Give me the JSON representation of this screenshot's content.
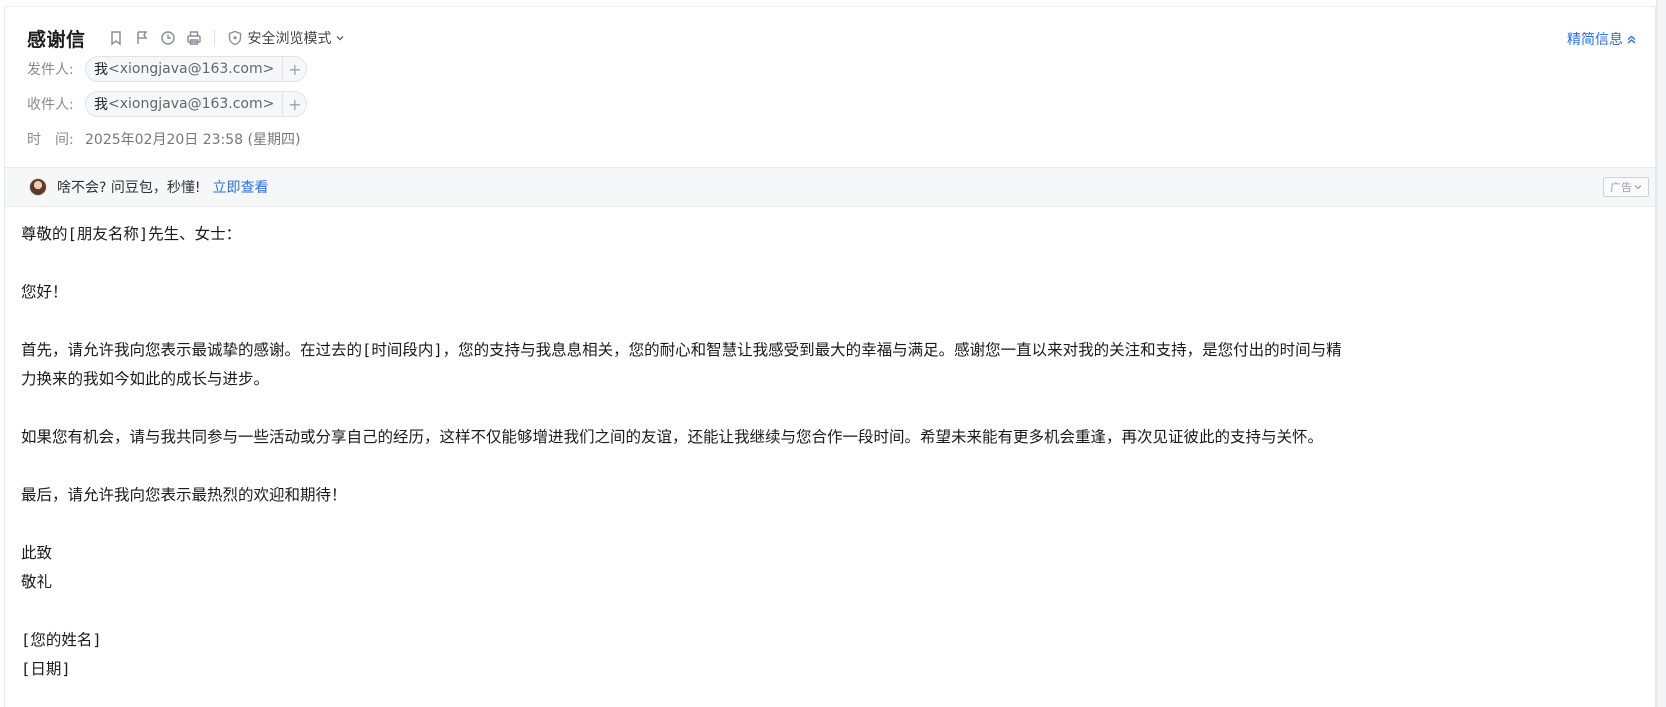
{
  "email": {
    "subject": "感谢信",
    "safe_mode_label": "安全浏览模式",
    "simplify_label": "精简信息",
    "sender": {
      "label": "发件人:",
      "name": "我",
      "address": "<xiongjava@163.com>"
    },
    "recipient": {
      "label": "收件人:",
      "name": "我",
      "address": "<xiongjava@163.com>"
    },
    "time": {
      "label": "时　间:",
      "value": "2025年02月20日 23:58 (星期四)"
    },
    "toolbar_icons": [
      "bookmark-icon",
      "flag-icon",
      "clock-icon",
      "print-icon"
    ],
    "add_symbol": "+"
  },
  "ad": {
    "text": "啥不会? 问豆包，秒懂!",
    "link": "立即查看",
    "badge": "广告"
  },
  "body": {
    "greeting": "尊敬的[朋友名称]先生、女士：",
    "hello": "您好！",
    "para1_line1": "首先，请允许我向您表示最诚挚的感谢。在过去的[时间段内]，您的支持与我息息相关，您的耐心和智慧让我感受到最大的幸福与满足。感谢您一直以来对我的关注和支持，是您付出的时间与精",
    "para1_line2": "力换来的我如今如此的成长与进步。",
    "para2": "如果您有机会，请与我共同参与一些活动或分享自己的经历，这样不仅能够增进我们之间的友谊，还能让我继续与您合作一段时间。希望未来能有更多机会重逢，再次见证彼此的支持与关怀。",
    "para3": "最后，请允许我向您表示最热烈的欢迎和期待！",
    "closing1": "此致",
    "closing2": "敬礼",
    "signature_name": "[您的姓名]",
    "signature_date": "[日期]"
  },
  "colors": {
    "link": "#2a6ee8",
    "chip_bg": "#f5f7fa"
  }
}
